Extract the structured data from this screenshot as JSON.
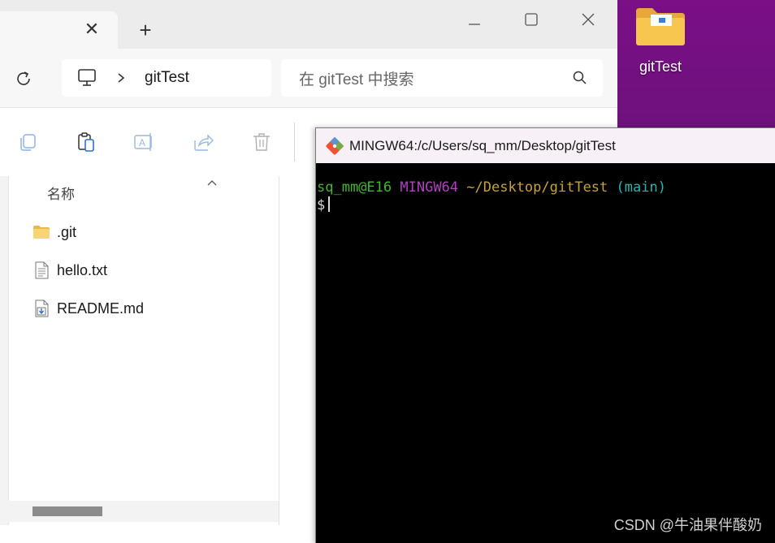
{
  "desktop": {
    "folder_label": "gitTest"
  },
  "explorer": {
    "tab": {
      "close_glyph": "✕"
    },
    "new_tab_glyph": "+",
    "window_controls": {
      "minimize": "—",
      "maximize": "☐",
      "close": "✕"
    },
    "breadcrumb": {
      "current_folder": "gitTest"
    },
    "search": {
      "placeholder": "在 gitTest 中搜索"
    },
    "toolbar_icons": [
      "copy-icon",
      "paste-icon",
      "rename-icon",
      "share-icon",
      "delete-icon"
    ],
    "file_list": {
      "column_header": "名称",
      "files": [
        {
          "name": ".git",
          "icon": "folder-icon"
        },
        {
          "name": "hello.txt",
          "icon": "text-file-icon"
        },
        {
          "name": "README.md",
          "icon": "markdown-file-icon"
        }
      ]
    }
  },
  "terminal": {
    "title": "MINGW64:/c/Users/sq_mm/Desktop/gitTest",
    "prompt": {
      "user_host": "sq_mm@E16",
      "system": "MINGW64",
      "path": "~/Desktop/gitTest",
      "branch": "(main)",
      "symbol": "$"
    },
    "colors": {
      "user_host": "#3fb82a",
      "system": "#b13fbf",
      "path": "#c6a13b",
      "branch": "#2bb3b0",
      "symbol": "#d8d8d8"
    }
  },
  "watermark": "CSDN @牛油果伴酸奶"
}
